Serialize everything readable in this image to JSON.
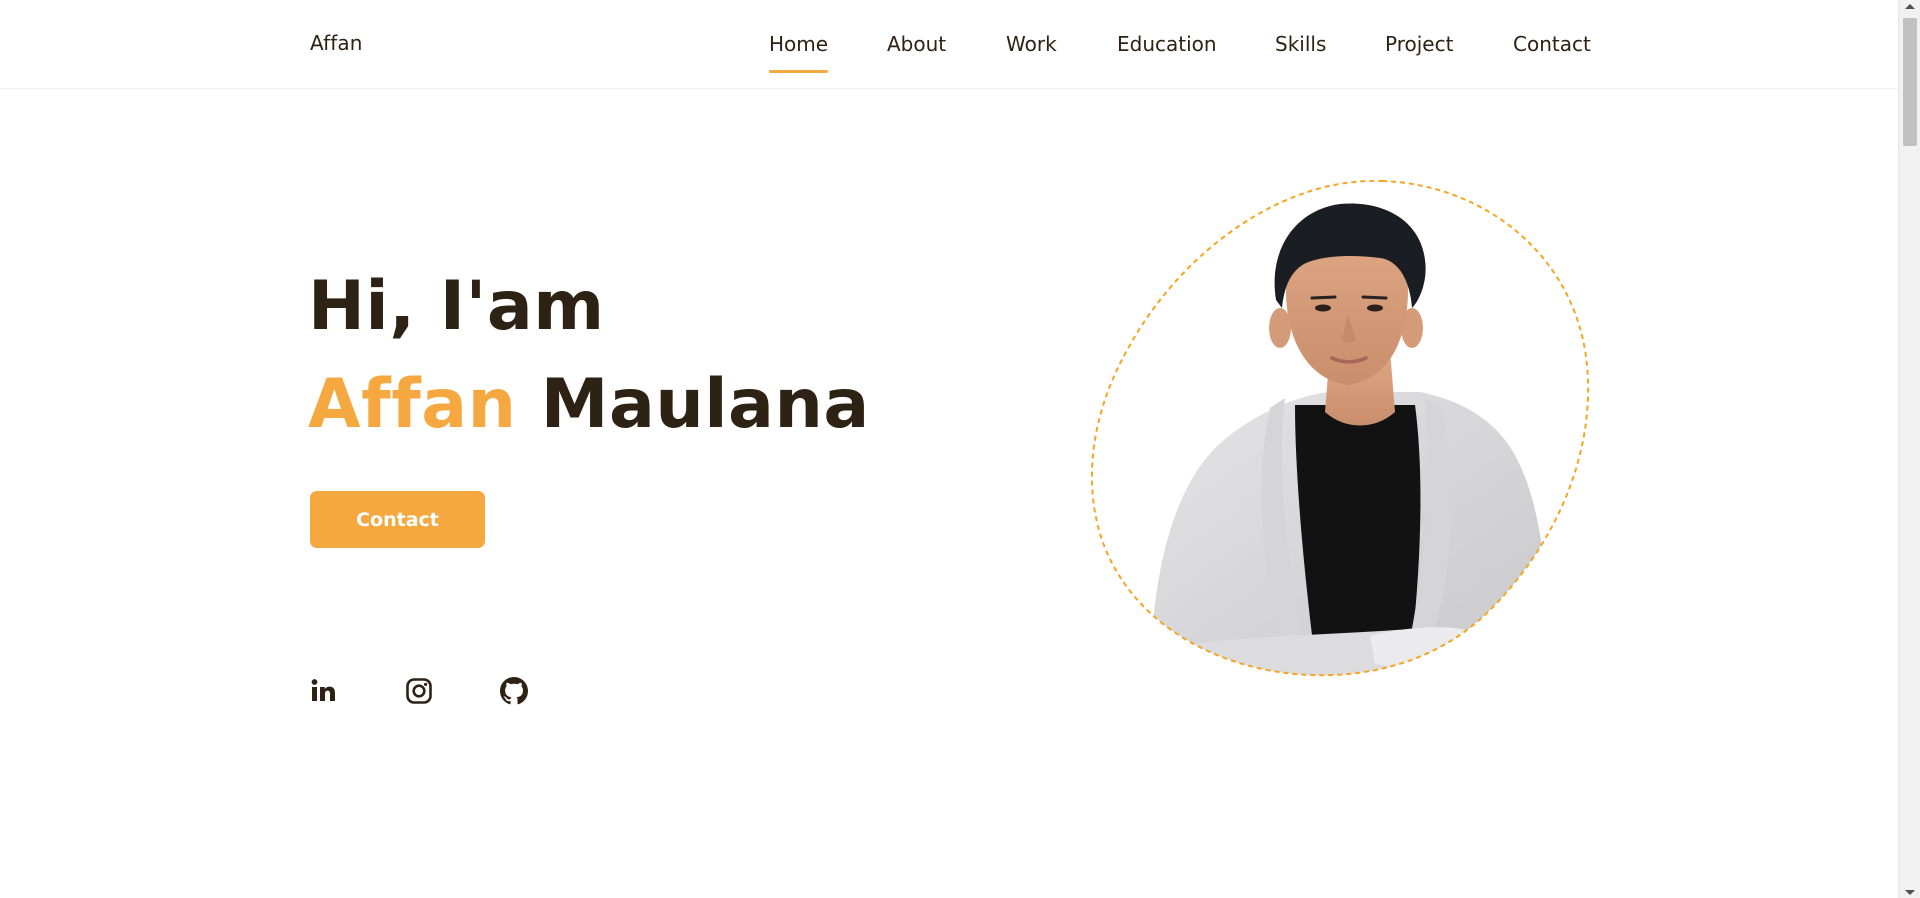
{
  "header": {
    "logo": "Affan",
    "nav": [
      {
        "label": "Home",
        "active": true
      },
      {
        "label": "About",
        "active": false
      },
      {
        "label": "Work",
        "active": false
      },
      {
        "label": "Education",
        "active": false
      },
      {
        "label": "Skills",
        "active": false
      },
      {
        "label": "Project",
        "active": false
      },
      {
        "label": "Contact",
        "active": false
      }
    ]
  },
  "hero": {
    "greeting": "Hi, I'am",
    "first_name": "Affan",
    "last_name": "Maulana",
    "cta_label": "Contact"
  },
  "social": [
    {
      "icon": "linkedin-icon"
    },
    {
      "icon": "instagram-icon"
    },
    {
      "icon": "github-icon"
    }
  ],
  "colors": {
    "accent": "#f5a83f",
    "text": "#2e2214",
    "background": "#ffffff"
  }
}
